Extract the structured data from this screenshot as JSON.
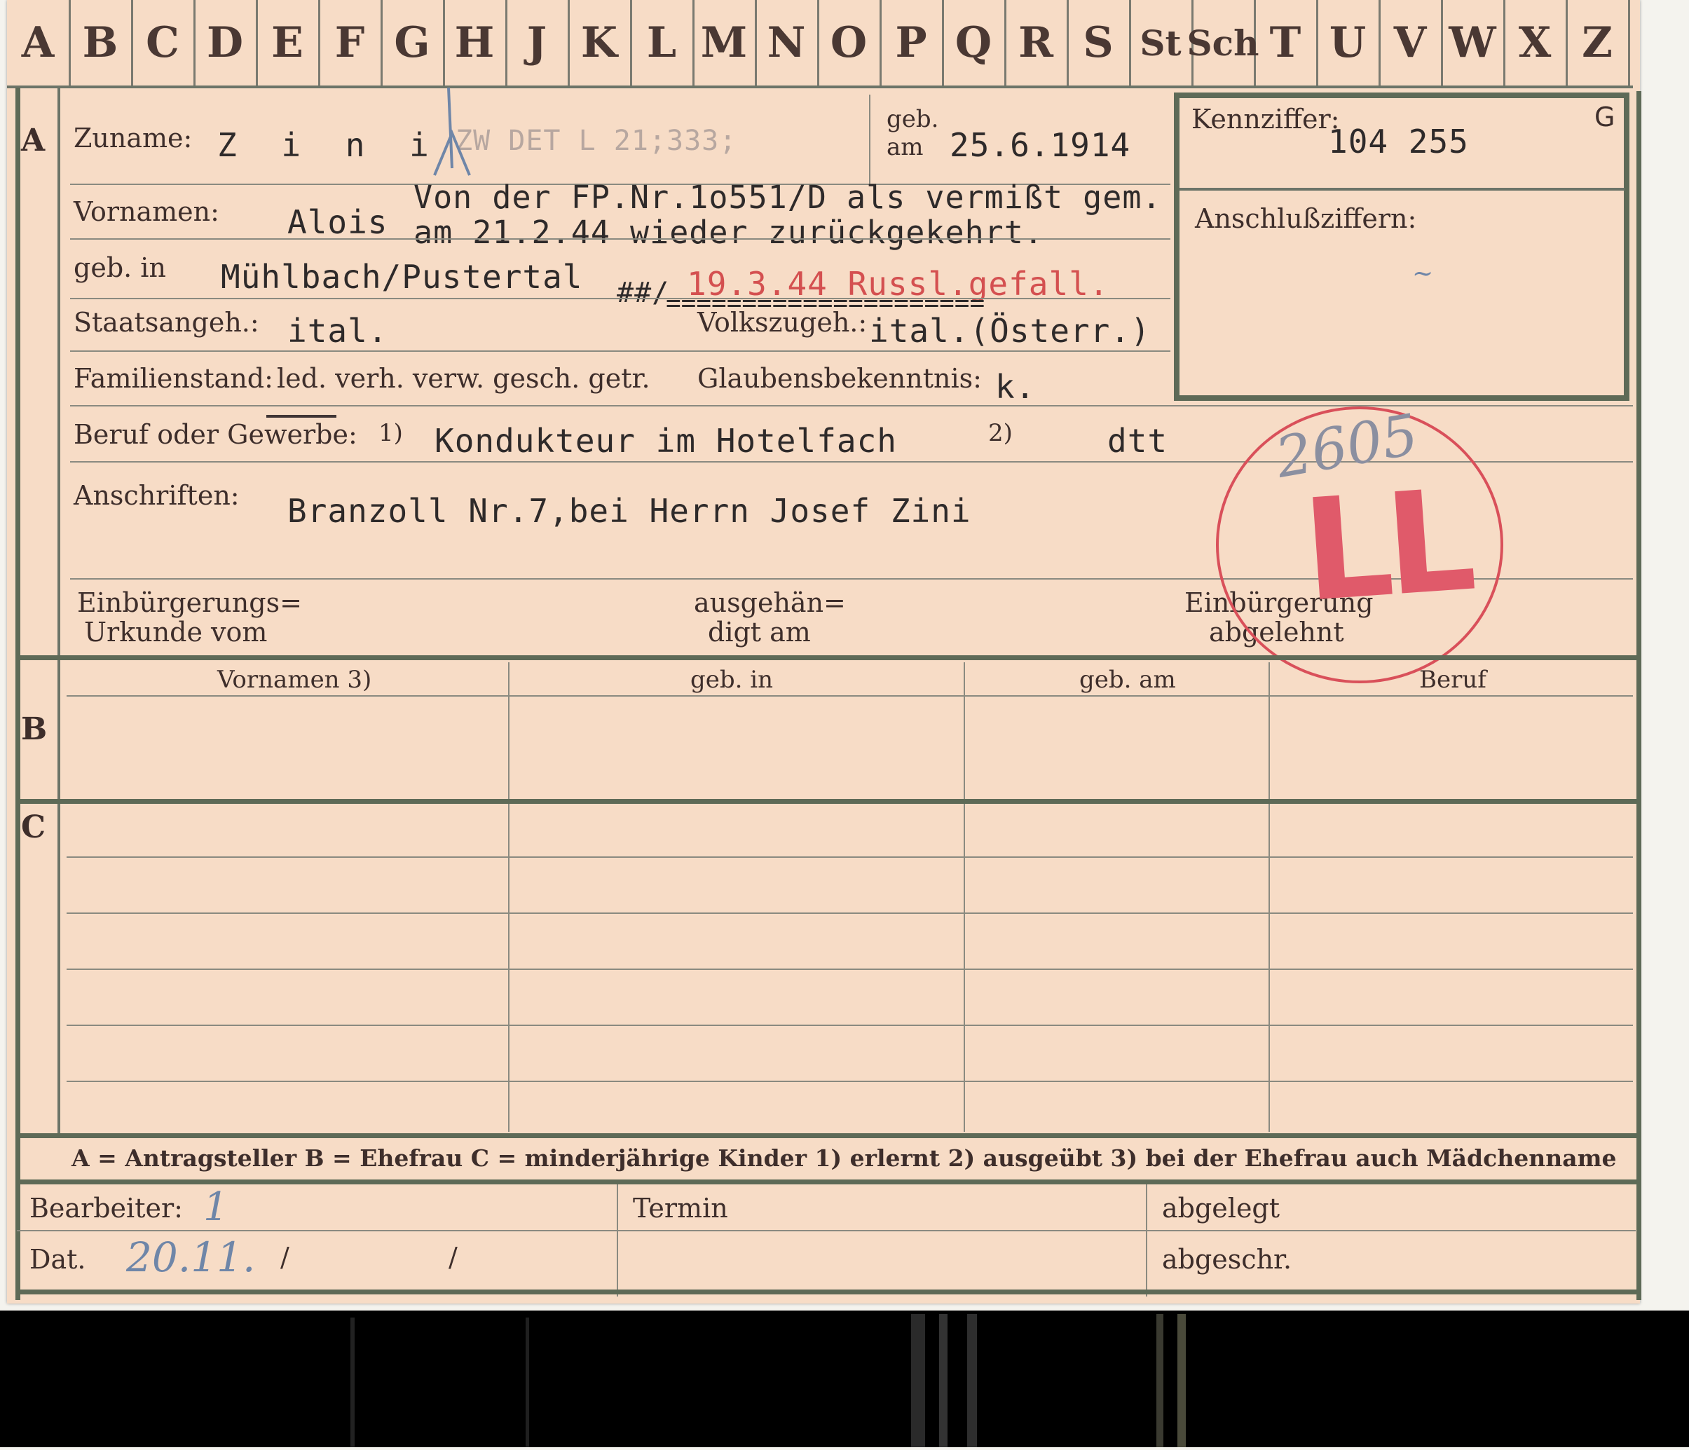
{
  "index_tabs": [
    "A",
    "B",
    "C",
    "D",
    "E",
    "F",
    "G",
    "H",
    "J",
    "K",
    "L",
    "M",
    "N",
    "O",
    "P",
    "Q",
    "R",
    "S",
    "St",
    "Sch",
    "T",
    "U",
    "V",
    "W",
    "X",
    "Z"
  ],
  "section_labels": {
    "a": "A",
    "b": "B",
    "c": "C"
  },
  "section_a": {
    "surname_label": "Zuname:",
    "surname_value": "Z i n i",
    "surname_faint": "ZW DET   L 21;333;",
    "birth_date_label_1": "geb.",
    "birth_date_label_2": "am",
    "birth_date_value": "25.6.1914",
    "id_label": "Kennziffer:",
    "id_value": "104 255",
    "id_corner": "G",
    "connection_label": "Anschlußziffern:",
    "note_line1": "Von der FP.Nr.1o551/D als vermißt gem.",
    "note_line2": "am 21.2.44 wieder zurückgekehrt.",
    "first_names_label": "Vornamen:",
    "first_names_value": "Alois",
    "birthplace_label": "geb. in",
    "birthplace_value": "Mühlbach/Pustertal",
    "red_note": "19.3.44 Russl.gefall.",
    "strike_marks": "##/",
    "strike_line": "=====================",
    "citizenship_label": "Staatsangeh.:",
    "citizenship_value": "ital.",
    "ethnicity_label": "Volkszugeh.:",
    "ethnicity_value": "ital.(Österr.)",
    "marital_label": "Familienstand:",
    "marital_options": "led. verh. verw. gesch. getr.",
    "religion_label": "Glaubensbekenntnis:",
    "religion_value": "k.",
    "occupation_label": "Beruf oder Gewerbe:",
    "occupation_mark1": "1)",
    "occupation_value1": "Kondukteur im Hotelfach",
    "occupation_mark2": "2)",
    "occupation_value2": "dtt",
    "address_label": "Anschriften:",
    "address_value": "Branzoll Nr.7,bei Herrn Josef Zini",
    "naturalization_doc_1": "Einbürgerungs=",
    "naturalization_doc_2": "Urkunde vom",
    "delivered_1": "ausgehän=",
    "delivered_2": "digt am",
    "naturalization_denied_1": "Einbürgerung",
    "naturalization_denied_2": "abgelehnt"
  },
  "stamp": {
    "handwritten": "2605",
    "big_mark": "LL"
  },
  "table_headers": [
    "Vornamen 3)",
    "geb. in",
    "geb. am",
    "Beruf"
  ],
  "legend": "A = Antragsteller   B = Ehefrau   C = minderjährige Kinder   1) erlernt   2) ausgeübt   3) bei der Ehefrau auch Mädchenname",
  "footer": {
    "editor_label": "Bearbeiter:",
    "editor_value": "1",
    "date_label": "Dat.",
    "date_value": "20.11.",
    "date_sep1": "/",
    "date_sep2": "/",
    "deadline_label": "Termin",
    "filed_label": "abgelegt",
    "copied_label": "abgeschr."
  },
  "colors": {
    "card": "#f7dcc6",
    "rule": "#5e6a57",
    "stamp": "#d9505a",
    "pencil": "#6f86a8"
  }
}
